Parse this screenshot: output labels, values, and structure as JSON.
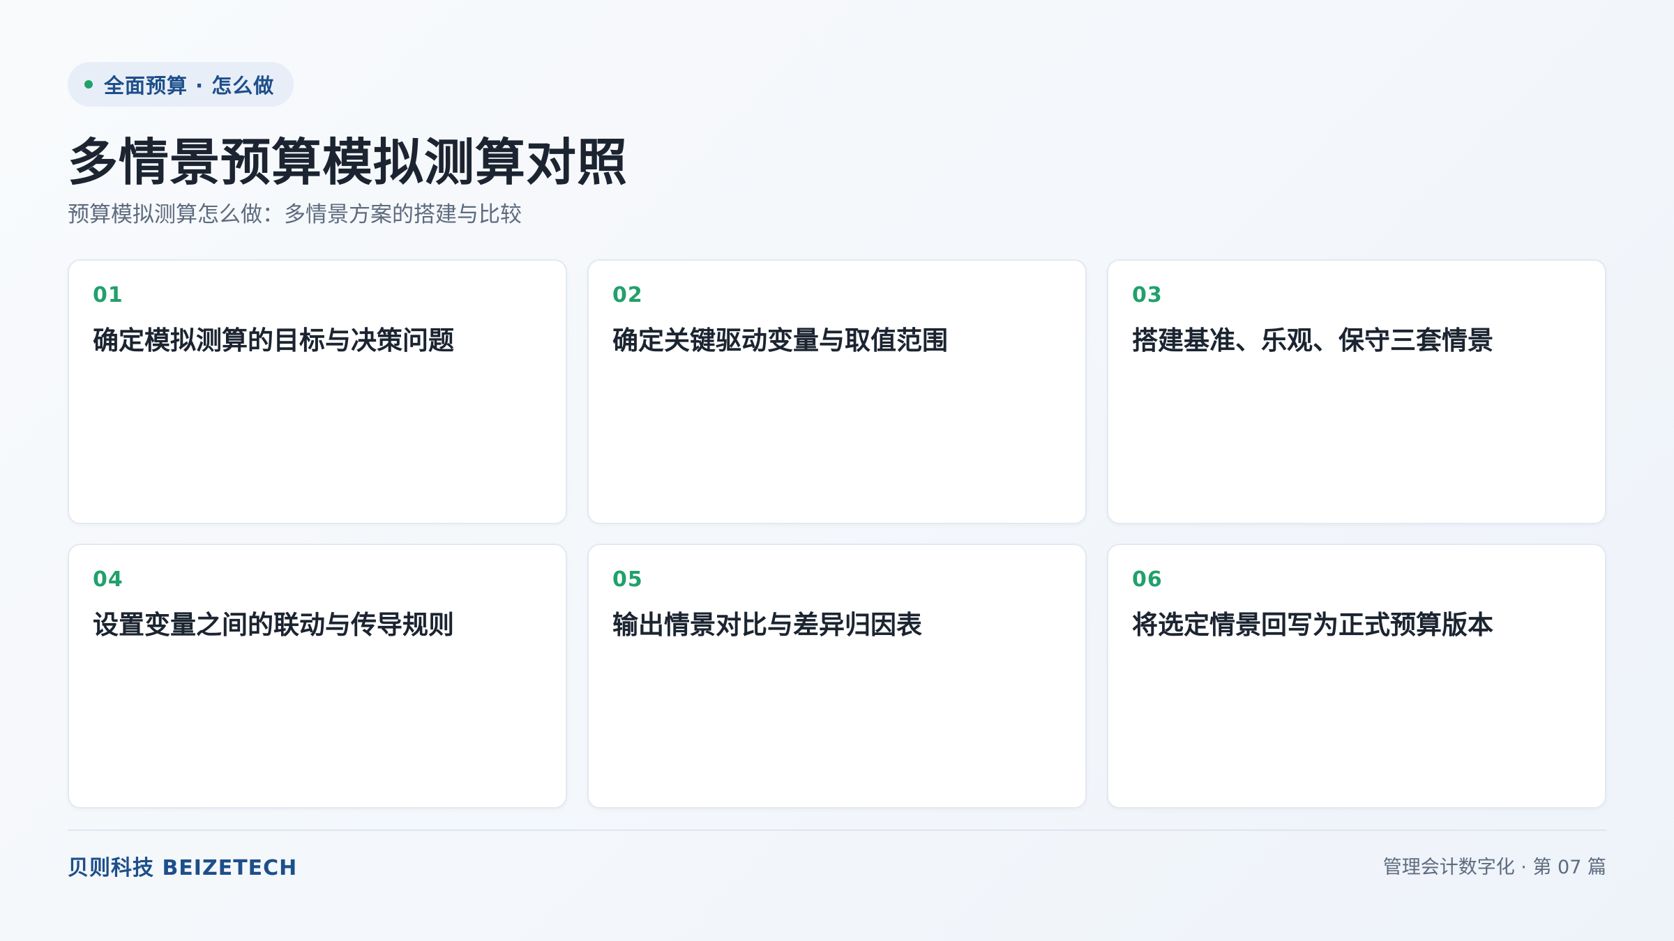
{
  "badge": {
    "text": "全面预算 · 怎么做",
    "dot_color": "#20a26b"
  },
  "header": {
    "title": "多情景预算模拟测算对照",
    "subtitle": "预算模拟测算怎么做：多情景方案的搭建与比较"
  },
  "cards": [
    {
      "num": "01",
      "title": "确定模拟测算的目标与决策问题"
    },
    {
      "num": "02",
      "title": "确定关键驱动变量与取值范围"
    },
    {
      "num": "03",
      "title": "搭建基准、乐观、保守三套情景"
    },
    {
      "num": "04",
      "title": "设置变量之间的联动与传导规则"
    },
    {
      "num": "05",
      "title": "输出情景对比与差异归因表"
    },
    {
      "num": "06",
      "title": "将选定情景回写为正式预算版本"
    }
  ],
  "footer": {
    "brand": "贝则科技 BEIZETECH",
    "series": "管理会计数字化 · 第 07 篇"
  },
  "colors": {
    "accent_green": "#22a06b",
    "brand_blue": "#1d4f8a",
    "text_dark": "#1b2430",
    "text_muted": "#5d6b7e"
  }
}
